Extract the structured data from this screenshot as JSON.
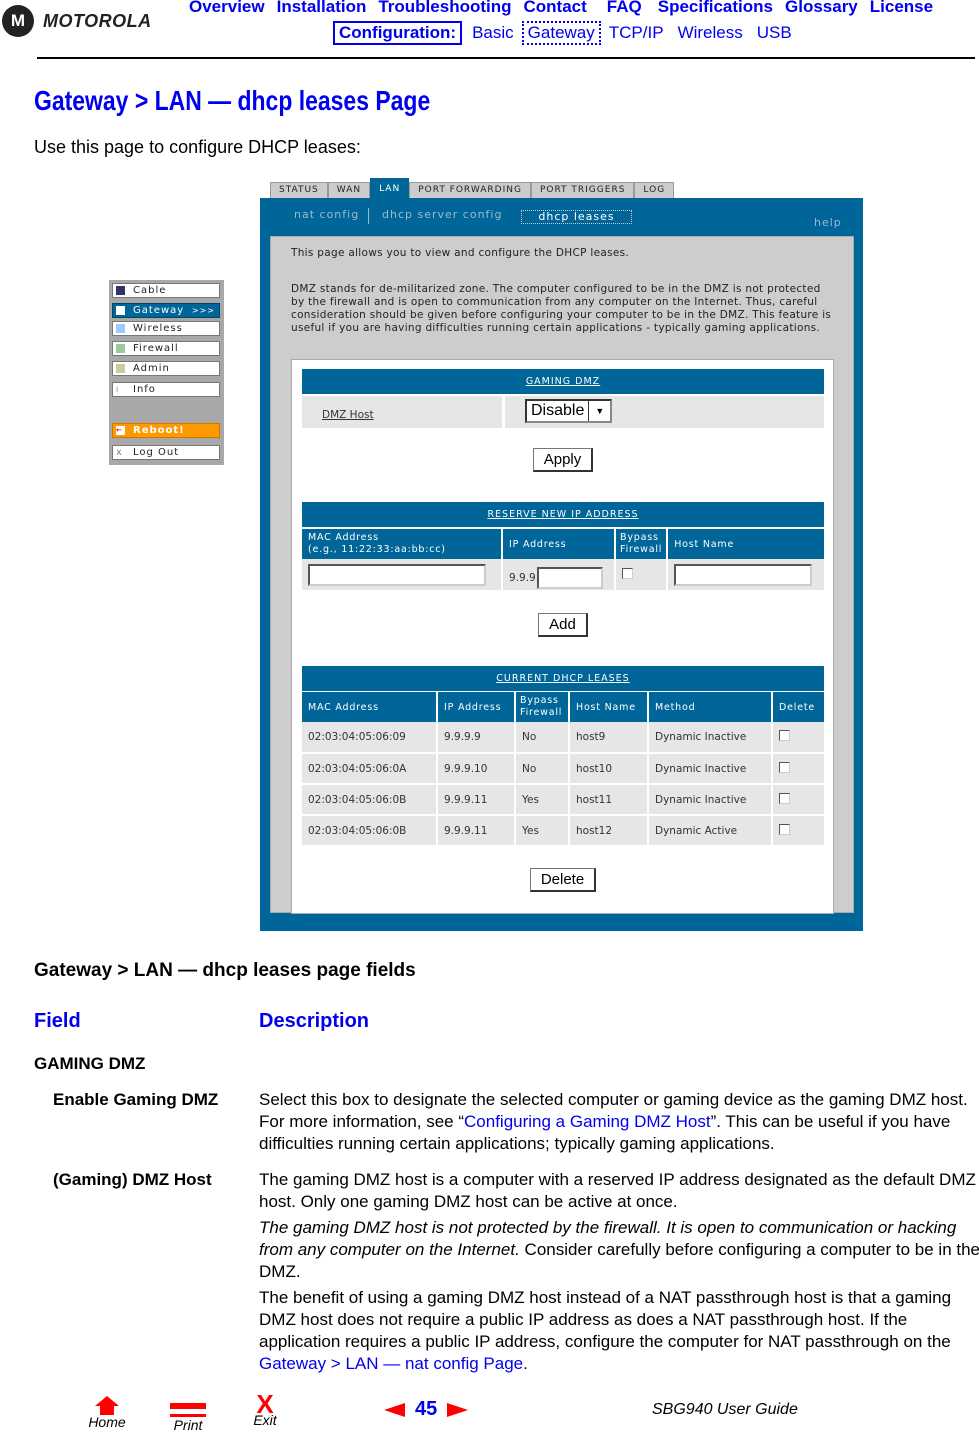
{
  "header": {
    "brand": "MOTOROLA",
    "nav": [
      "Overview",
      "Installation",
      "Troubleshooting",
      "Contact",
      "FAQ",
      "Specifications",
      "Glossary",
      "License"
    ],
    "config_label": "Configuration:",
    "config_links": [
      "Basic",
      "Gateway",
      "TCP/IP",
      "Wireless",
      "USB"
    ]
  },
  "page": {
    "title": "Gateway > LAN — dhcp leases Page",
    "intro": "Use this page to configure DHCP leases:"
  },
  "router": {
    "tabs": [
      "STATUS",
      "WAN",
      "LAN",
      "PORT FORWARDING",
      "PORT TRIGGERS",
      "LOG"
    ],
    "subtabs": [
      "nat config",
      "dhcp server config",
      "dhcp leases"
    ],
    "help": "help",
    "desc1": "This page allows you to view and configure the DHCP leases.",
    "desc2": "DMZ stands for de-militarized zone. The computer configured to be in the DMZ is not protected by the firewall and is open to communication from any computer on the Internet. Thus, careful consideration should be given before configuring your computer to be in the DMZ. This feature is useful if you are having difficulties running certain applications - typically gaming applications.",
    "gaming_dmz": {
      "title": "GAMING DMZ",
      "label": "DMZ Host",
      "select_value": "Disable",
      "apply": "Apply"
    },
    "reserve": {
      "title": "RESERVE NEW IP ADDRESS",
      "headers": [
        "MAC Address",
        "(e.g., 11:22:33:aa:bb:cc)",
        "IP Address",
        "Bypass",
        "Firewall",
        "Host Name"
      ],
      "ip_prefix": "9.9.9.",
      "add": "Add"
    },
    "leases": {
      "title": "CURRENT DHCP LEASES",
      "headers": [
        "MAC Address",
        "IP Address",
        "Bypass",
        "Firewall",
        "Host Name",
        "Method",
        "Delete"
      ],
      "rows": [
        [
          "02:03:04:05:06:09",
          "9.9.9.9",
          "No",
          "host9",
          "Dynamic Inactive"
        ],
        [
          "02:03:04:05:06:0A",
          "9.9.9.10",
          "No",
          "host10",
          "Dynamic Inactive"
        ],
        [
          "02:03:04:05:06:0B",
          "9.9.9.11",
          "Yes",
          "host11",
          "Dynamic Inactive"
        ],
        [
          "02:03:04:05:06:0B",
          "9.9.9.11",
          "Yes",
          "host12",
          "Dynamic Active"
        ]
      ],
      "delete": "Delete"
    },
    "sidebar": [
      "Cable",
      "Gateway",
      "Wireless",
      "Firewall",
      "Admin",
      "Info",
      "Reboot!",
      "Log Out"
    ],
    "sidebar_arrow": ">>>"
  },
  "fields": {
    "heading": "Gateway > LAN — dhcp leases page fields",
    "col_field": "Field",
    "col_desc": "Description",
    "group": "GAMING DMZ",
    "f1": {
      "name": "Enable Gaming DMZ",
      "d_a": "Select this box to designate the selected computer or gaming device as the gaming DMZ host. For more information, see “",
      "d_link": "Configuring a Gaming DMZ Host",
      "d_b": "”. This can be useful if you have difficulties running certain applications; typically gaming applications."
    },
    "f2": {
      "name": "(Gaming) DMZ Host",
      "p1": "The gaming DMZ host is a computer with a reserved IP address designated as the default DMZ host. Only one gaming DMZ host can be active at once.",
      "p2_i": "The gaming DMZ host is not protected by the firewall. It is open to communication or hacking from any computer on the Internet.",
      "p2_b": " Consider carefully before configuring a computer to be in the DMZ.",
      "p3": "The benefit of using a gaming DMZ host instead of a NAT passthrough host is that a gaming DMZ host does not require a public IP address as does a NAT passthrough host. If the application requires a public IP address, configure the computer for NAT passthrough on the ",
      "p3_link": "Gateway > LAN — nat config Page",
      "p3_end": "."
    }
  },
  "footer": {
    "home": "Home",
    "print": "Print",
    "exit": "Exit",
    "page": "45",
    "guide": "SBG940 User Guide"
  },
  "colors": {
    "link": "#0000ee",
    "panel": "#006699",
    "accent": "#ff0000",
    "reboot": "#ff9900"
  }
}
